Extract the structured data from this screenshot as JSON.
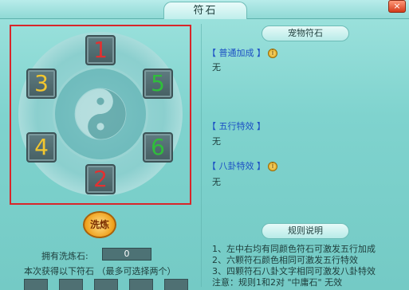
{
  "window": {
    "title": "符石",
    "close_symbol": "×"
  },
  "wheel": {
    "slots": [
      {
        "label": "1",
        "color": "#e23131"
      },
      {
        "label": "3",
        "color": "#f1c62f"
      },
      {
        "label": "5",
        "color": "#2fbe3b"
      },
      {
        "label": "4",
        "color": "#f1c62f"
      },
      {
        "label": "6",
        "color": "#2fbe3b"
      },
      {
        "label": "2",
        "color": "#e23131"
      }
    ]
  },
  "actions": {
    "wash_label": "洗炼",
    "own_label": "拥有洗炼石:",
    "own_value": "0",
    "obtain_text": "本次获得以下符石 （最多可选择两个）"
  },
  "right": {
    "header": "宠物符石",
    "normal_bonus_label": "【 普通加成 】",
    "normal_bonus_value": "无",
    "wuxing_label": "【 五行特效 】",
    "wuxing_value": "无",
    "bagua_label": "【 八卦特效 】",
    "bagua_value": "无",
    "rules_header": "规则说明",
    "rules": [
      "1、左中右均有同颜色符石可激发五行加成",
      "2、六颗符石颜色相同可激发五行特效",
      "3、四颗符石八卦文字相同可激发八卦特效",
      "注意：规则1和2对 \"中庸石\" 无效"
    ]
  },
  "colors": {
    "accent_blue": "#1b4fc4",
    "highlight_red": "#d8262a"
  }
}
